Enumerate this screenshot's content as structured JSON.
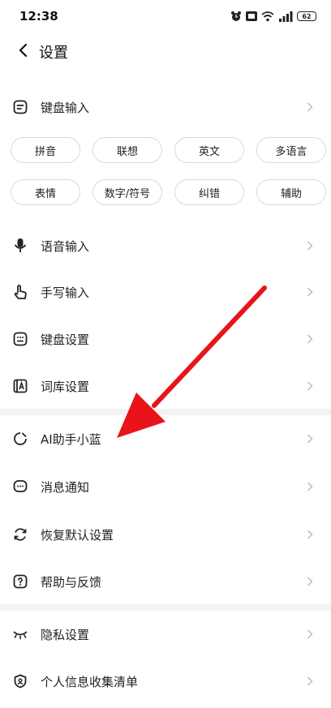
{
  "status_bar": {
    "time": "12:38",
    "battery": "62"
  },
  "header": {
    "title": "设置"
  },
  "keyboard_input": {
    "label": "键盘输入",
    "chips": [
      "拼音",
      "联想",
      "英文",
      "多语言",
      "表情",
      "数字/符号",
      "纠错",
      "辅助"
    ]
  },
  "menu_group_1": [
    {
      "label": "语音输入",
      "icon": "microphone-icon"
    },
    {
      "label": "手写输入",
      "icon": "hand-pointer-icon"
    },
    {
      "label": "键盘设置",
      "icon": "keyboard-icon"
    },
    {
      "label": "词库设置",
      "icon": "dictionary-icon"
    }
  ],
  "menu_group_2": [
    {
      "label": "AI助手小蓝",
      "icon": "ai-assistant-icon"
    },
    {
      "label": "消息通知",
      "icon": "message-icon"
    },
    {
      "label": "恢复默认设置",
      "icon": "refresh-icon"
    },
    {
      "label": "帮助与反馈",
      "icon": "help-icon"
    }
  ],
  "menu_group_3": [
    {
      "label": "隐私设置",
      "icon": "closed-eye-icon"
    },
    {
      "label": "个人信息收集清单",
      "icon": "shield-icon"
    }
  ],
  "annotation": {
    "color": "#e8141a"
  }
}
